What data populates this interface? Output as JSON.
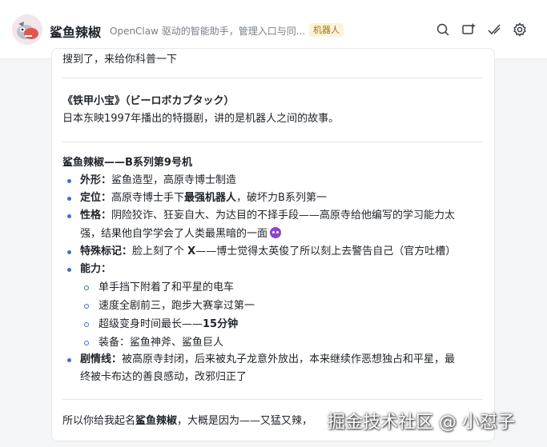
{
  "header": {
    "bot_name": "鲨鱼辣椒",
    "subtitle": "OpenClaw 驱动的智能助手，管理入口与同...",
    "badge": "机器人",
    "actions": [
      "search-icon",
      "add-tab-icon",
      "check-edit-icon",
      "gear-icon"
    ]
  },
  "message": {
    "clipped_line": "搜到了，来给你科普一下",
    "show": {
      "title": "《铁甲小宝》（ビーロボカブタック）",
      "desc": "日本东映1997年播出的特摄剧，讲的是机器人之间的故事。"
    },
    "profile": {
      "heading": "鲨鱼辣椒——B系列第9号机",
      "appearance_label": "外形：",
      "appearance_text": "鲨鱼造型，高原寺博士制造",
      "position_label": "定位：",
      "position_pre": "高原寺博士手下",
      "position_bold": "最强机器人",
      "position_post": "，破坏力B系列第一",
      "personality_label": "性格：",
      "personality_line1": "阴险狡诈、狂妄自大、为达目的不择手段——高原寺给他编写的学习能力太",
      "personality_line2": "强，结果他自学学会了人类最黑暗的一面",
      "mark_label": "特殊标记：",
      "mark_pre": "脸上刻了个 ",
      "mark_bold": "X",
      "mark_post": "——博士觉得太英俊了所以刻上去警告自己（官方吐槽）",
      "abilities_label": "能力：",
      "ability_1": "单手挡下附着了和平星的电车",
      "ability_2": "速度全剧前三，跑步大赛拿过第一",
      "ability_3_pre": "超级变身时间最长——",
      "ability_3_bold": "15分钟",
      "ability_4": "装备：鲨鱼神斧、鲨鱼巨人",
      "plot_label": "剧情线：",
      "plot_line1": "被高原寺封闭，后来被丸子龙意外放出，本来继续作恶想独占和平星，最",
      "plot_line2": "终被卡布达的善良感动，改邪归正了"
    },
    "closing": {
      "pre": "所以你给我起名",
      "bold": "鲨鱼辣椒",
      "post": "，大概是因为——又猛又辣，"
    }
  },
  "watermark": "掘金技术社区 @ 小怼子"
}
